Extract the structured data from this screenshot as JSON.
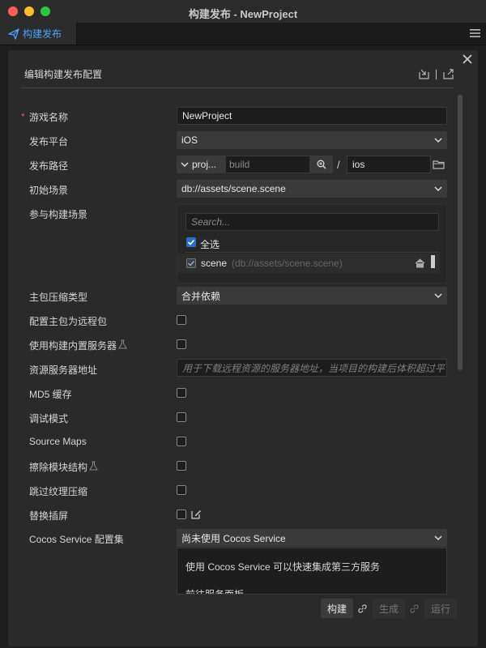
{
  "window": {
    "title": "构建发布 - NewProject"
  },
  "tab": {
    "label": "构建发布"
  },
  "panel": {
    "title": "编辑构建发布配置"
  },
  "form": {
    "game_name": {
      "label": "游戏名称",
      "required_mark": "*",
      "value": "NewProject"
    },
    "platform": {
      "label": "发布平台",
      "value": "iOS"
    },
    "build_path": {
      "label": "发布路径",
      "prefix": "proj...",
      "placeholder": "build",
      "separator": "/",
      "value": "ios"
    },
    "start_scene": {
      "label": "初始场景",
      "value": "db://assets/scene.scene"
    },
    "included_scenes": {
      "label": "参与构建场景",
      "search_placeholder": "Search...",
      "select_all_label": "全选",
      "select_all_checked": true,
      "scenes": [
        {
          "name": "scene",
          "path": "(db://assets/scene.scene)",
          "checked": true
        }
      ]
    },
    "main_bundle_compression": {
      "label": "主包压缩类型",
      "value": "合并依赖"
    },
    "main_bundle_remote": {
      "label": "配置主包为远程包",
      "checked": false
    },
    "builtin_server": {
      "label": "使用构建内置服务器",
      "checked": false
    },
    "resource_server": {
      "label": "资源服务器地址",
      "placeholder": "用于下载远程资源的服务器地址，当项目的构建后体积超过平台"
    },
    "md5_cache": {
      "label": "MD5 缓存",
      "checked": false
    },
    "debug_mode": {
      "label": "调试模式",
      "checked": false
    },
    "source_maps": {
      "label": "Source Maps",
      "checked": false
    },
    "erase_module": {
      "label": "擦除模块结构",
      "checked": false
    },
    "skip_texture": {
      "label": "跳过纹理压缩",
      "checked": false
    },
    "replace_splash": {
      "label": "替换插屏",
      "checked": false
    },
    "cocos_service": {
      "label": "Cocos Service 配置集",
      "value": "尚未使用 Cocos Service",
      "description": "使用 Cocos Service 可以快速集成第三方服务",
      "link_text": "前往服务面板"
    }
  },
  "footer": {
    "build": "构建",
    "generate": "生成",
    "run": "运行"
  },
  "colors": {
    "accent": "#4da3ff",
    "required": "#e05a5a",
    "checkbox": "#2a6fc9"
  }
}
